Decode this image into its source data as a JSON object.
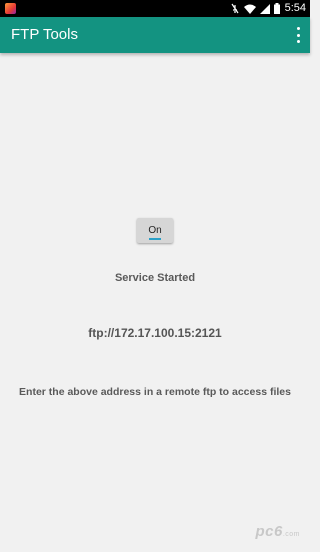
{
  "status_bar": {
    "time": "5:54",
    "icons": [
      "app-notification-icon",
      "mute-icon",
      "wifi-icon",
      "signal-icon",
      "battery-icon"
    ]
  },
  "app_bar": {
    "title": "FTP Tools",
    "menu_icon": "overflow-menu-icon",
    "color": "#139381"
  },
  "main": {
    "toggle_label": "On",
    "status": "Service Started",
    "address": "ftp://172.17.100.15:2121",
    "instructions": "Enter the above address in a remote ftp to access files"
  },
  "watermark": {
    "brand": "pc6",
    "domain": ".com"
  },
  "colors": {
    "accent": "#139381",
    "toggle_indicator": "#2aa0c8",
    "background": "#f1f1f1"
  }
}
